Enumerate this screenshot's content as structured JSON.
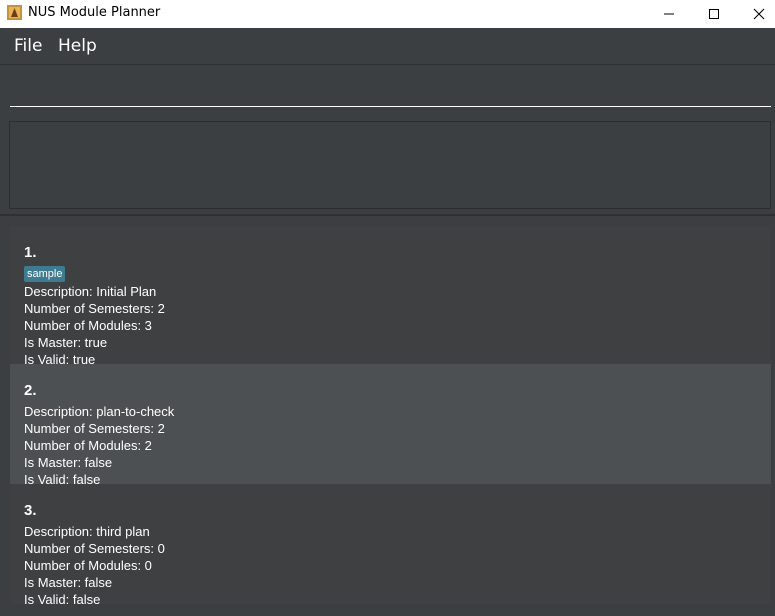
{
  "window": {
    "title": "NUS Module Planner"
  },
  "menu": {
    "file_label": "File",
    "help_label": "Help"
  },
  "command": {
    "value": "",
    "placeholder": ""
  },
  "result": {
    "text": ""
  },
  "plans": [
    {
      "index": "1.",
      "tag": "sample",
      "description": "Description: Initial Plan",
      "semesters": "Number of Semesters: 2",
      "modules": "Number of Modules: 3",
      "is_master": "Is Master: true",
      "is_valid": "Is Valid: true"
    },
    {
      "index": "2.",
      "description": "Description: plan-to-check",
      "semesters": "Number of Semesters: 2",
      "modules": "Number of Modules: 2",
      "is_master": "Is Master: false",
      "is_valid": "Is Valid: false"
    },
    {
      "index": "3.",
      "description": "Description: third plan",
      "semesters": "Number of Semesters: 0",
      "modules": "Number of Modules: 0",
      "is_master": "Is Master: false",
      "is_valid": "Is Valid: false"
    }
  ],
  "colors": {
    "background": "#3c3f41",
    "selected_card": "#4d5052",
    "tag": "#3e7b91",
    "text": "#ffffff"
  },
  "icons": {
    "app": "app-icon",
    "minimize": "minimize-icon",
    "maximize": "maximize-icon",
    "close": "close-icon"
  }
}
